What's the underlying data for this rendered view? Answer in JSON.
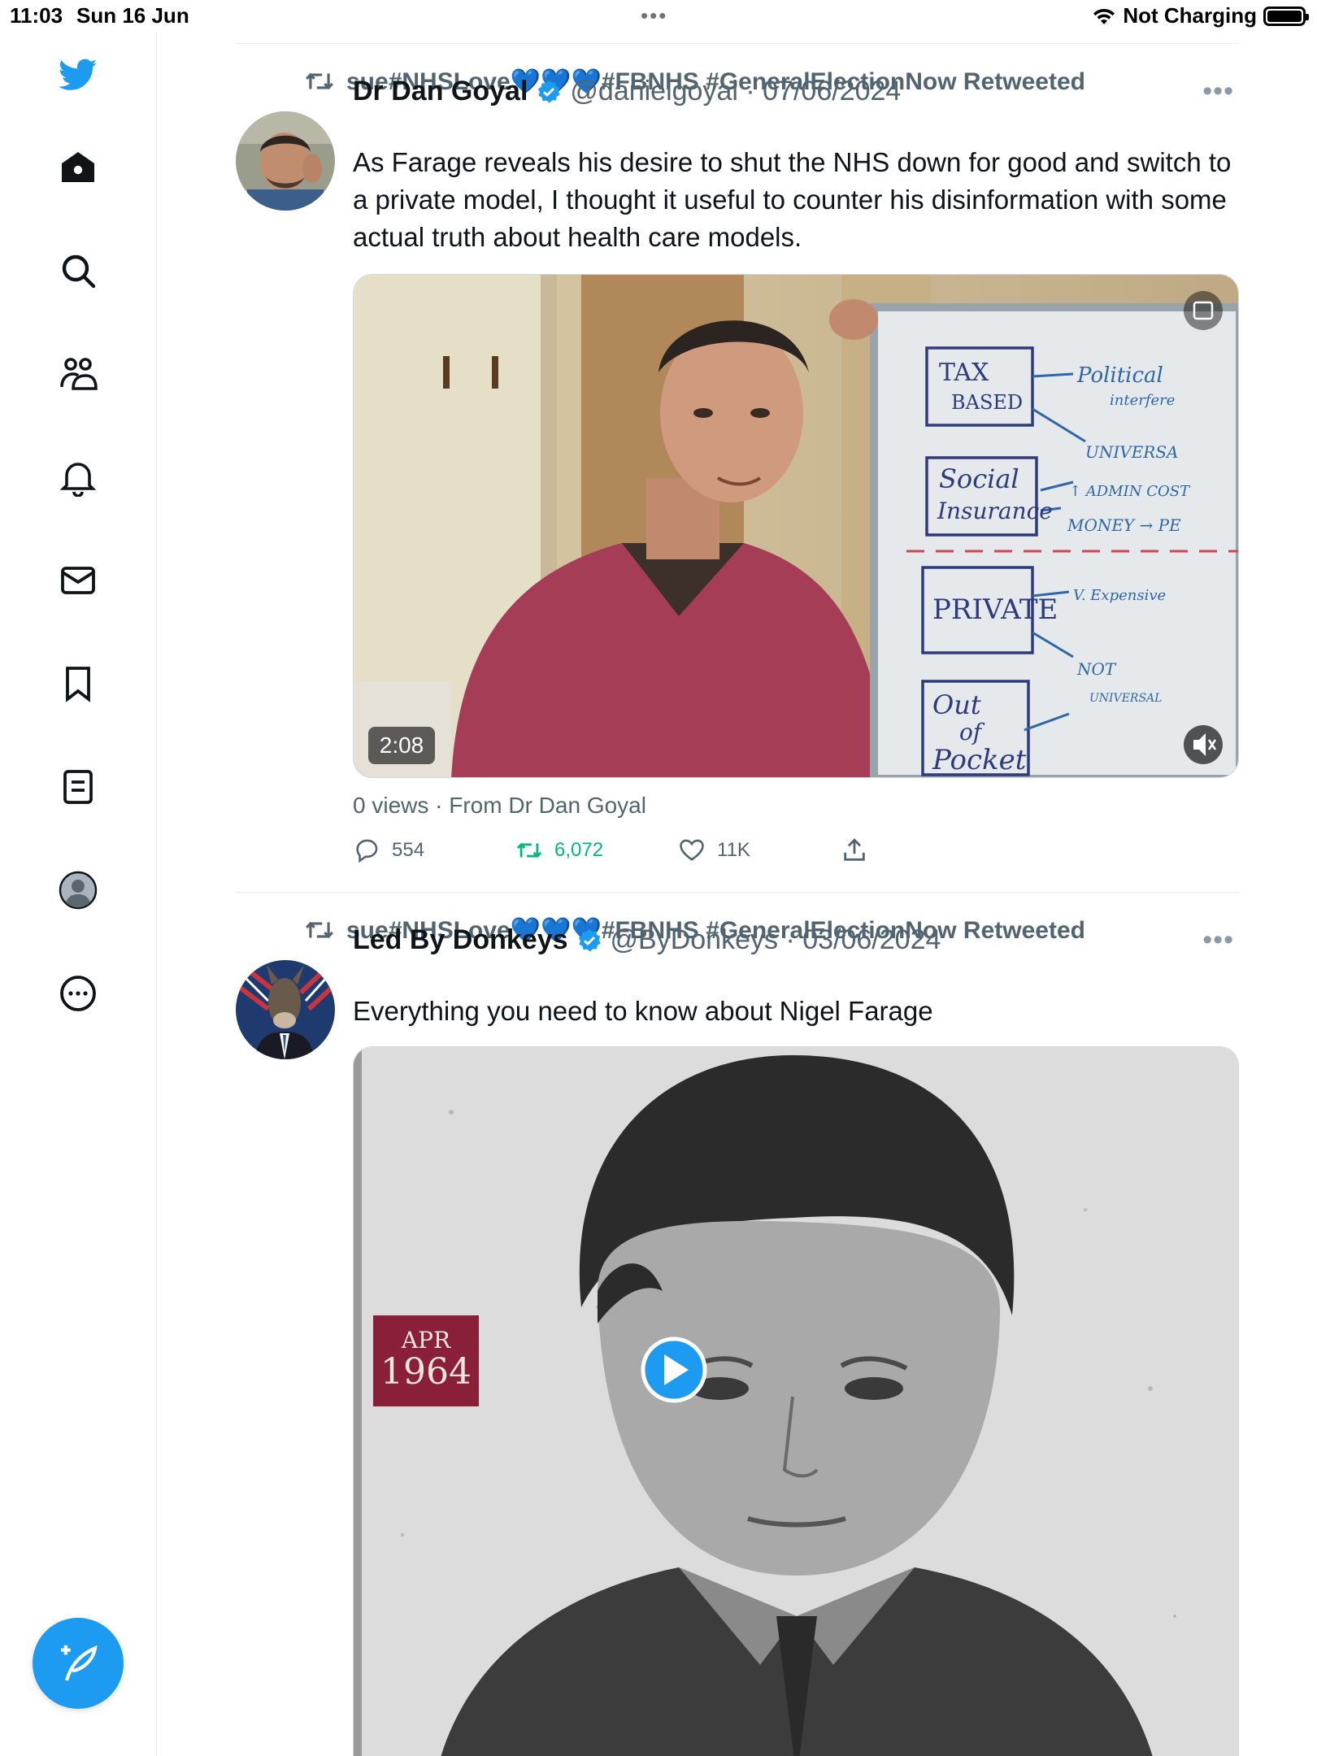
{
  "status_bar": {
    "time": "11:03",
    "date": "Sun 16 Jun",
    "dots": "•••",
    "charging": "Not Charging"
  },
  "sidebar": {
    "icons": [
      "twitter-bird-icon",
      "home-icon",
      "search-icon",
      "communities-icon",
      "notifications-icon",
      "messages-icon",
      "bookmarks-icon",
      "lists-icon",
      "profile-icon",
      "more-icon"
    ]
  },
  "colors": {
    "accent": "#1d9bf0",
    "retweet_green": "#00ba7c",
    "muted": "#536471"
  },
  "tweets": [
    {
      "retweeted_by": "sue#NHSLove💙💙💙#FBNHS #GeneralElectionNow Retweeted",
      "name": "Dr Dan Goyal",
      "handle_date": "@danielgoyal · 07/06/2024",
      "text": "As Farage reveals his desire to shut the NHS down for good and switch to a private model, I thought it useful to counter his disinformation with some actual truth about health care models.",
      "video_duration": "2:08",
      "whiteboard": {
        "tax": "TAX",
        "based": "BASED",
        "social": "Social",
        "insurance": "Insurance",
        "private": "PRIVATE",
        "out": "Out",
        "of": "of",
        "pocket": "Pocket",
        "political": "Political",
        "interference": "interfere",
        "universal": "UNIVERSA",
        "admin": "↑ ADMIN COST",
        "money": "MONEY → PE",
        "expensive": "V. Expensive",
        "not": "NOT",
        "universal2": "UNIVERSAL"
      },
      "views_source": "0 views · From Dr Dan Goyal",
      "actions": {
        "replies": "554",
        "retweets": "6,072",
        "likes": "11K"
      }
    },
    {
      "retweeted_by": "sue#NHSLove💙💙💙#FBNHS #GeneralElectionNow Retweeted",
      "name": "Led By Donkeys",
      "handle_date": "@ByDonkeys · 03/06/2024",
      "text": "Everything you need to know about Nigel Farage",
      "date_badge": {
        "month": "APR",
        "year": "1964"
      }
    }
  ]
}
